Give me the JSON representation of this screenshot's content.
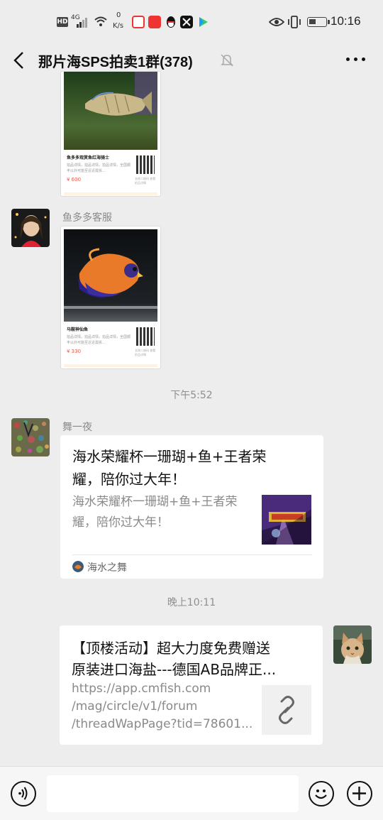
{
  "status_bar": {
    "hd": "HD",
    "network": "4G",
    "speed_value": "0",
    "speed_unit": "K/s",
    "time": "10:16"
  },
  "header": {
    "title": "那片海SPS拍卖1群(378)"
  },
  "messages": [
    {
      "type": "mini-program",
      "title": "鱼多多观赏鱼红海骑士",
      "desc": "拍品详情，拍品详情，拍品详情，全国顺丰以外可能至近近需拆...",
      "price": "¥ 600",
      "qr_note": "长按二维码 查看拍品详情"
    },
    {
      "type": "mini-program",
      "sender": "鱼多多客服",
      "title": "马鞍神仙鱼",
      "desc": "拍品详情，拍品详情，拍品详情，全国顺丰以外可能至近近需拆...",
      "price": "¥ 330",
      "qr_note": "长按二维码 查看拍品详情"
    },
    {
      "type": "timestamp",
      "text": "下午5:52"
    },
    {
      "type": "article",
      "sender": "舞一夜",
      "title_line1": "海水荣耀杯一珊瑚+鱼+王者荣",
      "title_line2": "耀，陪你过大年！",
      "desc_line1": "海水荣耀杯一珊瑚+鱼+王者荣",
      "desc_line2": "耀，陪你过大年！",
      "source": "海水之舞"
    },
    {
      "type": "timestamp",
      "text": "晚上10:11"
    },
    {
      "type": "link",
      "title_line1": "【顶楼活动】超大力度免费赠送",
      "title_line2": "原装进口海盐---德国AB品牌正...",
      "url_line1": "https://app.cmfish.com",
      "url_line2": "/mag/circle/v1/forum",
      "url_line3": "/threadWapPage?tid=78601..."
    }
  ],
  "colors": {
    "background": "#ededed",
    "bubble": "#ffffff",
    "price": "#ee5544",
    "timestamp": "#8f8f8f"
  },
  "icons": [
    "back-arrow-icon",
    "mute-bell-icon",
    "more-icon",
    "voice-icon",
    "emoji-icon",
    "plus-icon",
    "link-icon"
  ]
}
